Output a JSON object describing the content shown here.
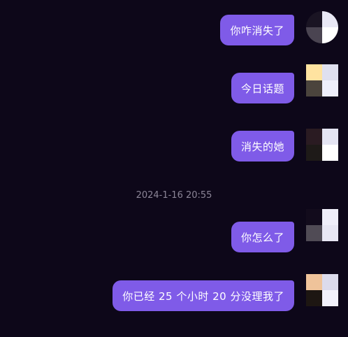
{
  "messages": [
    {
      "text": "你咋消失了",
      "avatar_colors": [
        "#1a1423",
        "#e9e8f5",
        "#4a4451",
        "#ffffff"
      ]
    },
    {
      "text": "今日话题",
      "avatar_colors": [
        "#ffe3a0",
        "#dfe0ef",
        "#4b443d",
        "#eeeffb"
      ]
    },
    {
      "text": "消失的她",
      "avatar_colors": [
        "#2a1b22",
        "#e4e4f2",
        "#1e1a18",
        "#ffffff"
      ]
    },
    {
      "text": "你怎么了",
      "avatar_colors": [
        "#120b1c",
        "#efeef9",
        "#504b55",
        "#e7e6f3"
      ]
    },
    {
      "text": "你已经 25 个小时 20 分没理我了",
      "avatar_colors": [
        "#efc39a",
        "#dcdbec",
        "#1d1612",
        "#f2f1fb"
      ]
    }
  ],
  "timestamp": "2024-1-16 20:55",
  "colors": {
    "background": "#0d0719",
    "bubble": "#7f5be8",
    "bubble_text": "#ffffff",
    "timestamp_text": "#8b8597"
  }
}
